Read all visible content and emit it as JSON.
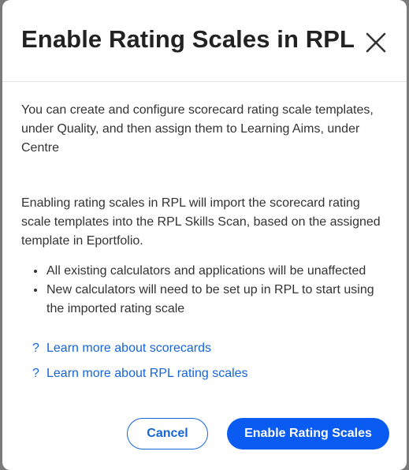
{
  "modal": {
    "title": "Enable Rating Scales in RPL",
    "close_icon": "close-icon",
    "paragraph1": "You can create and configure scorecard rating scale templates, under Quality, and then assign them to Learning Aims, under Centre",
    "paragraph2": "Enabling rating scales in RPL will import the scorecard rating scale templates into the RPL Skills Scan, based on the assigned template in Eportfolio.",
    "bullets": [
      "All existing calculators and applications will be unaffected",
      "New calculators will need to be set up in RPL to start using the imported rating scale"
    ],
    "links": [
      {
        "icon": "help-icon",
        "symbol": "?",
        "label": "Learn more about scorecards"
      },
      {
        "icon": "help-icon",
        "symbol": "?",
        "label": "Learn more about RPL rating scales"
      }
    ],
    "buttons": {
      "cancel": "Cancel",
      "enable": "Enable Rating Scales"
    }
  },
  "colors": {
    "accent": "#1565d8",
    "primary_button": "#0a5bf2",
    "title_text": "#222222",
    "body_text": "#333333",
    "backdrop": "#7a7a7a"
  }
}
